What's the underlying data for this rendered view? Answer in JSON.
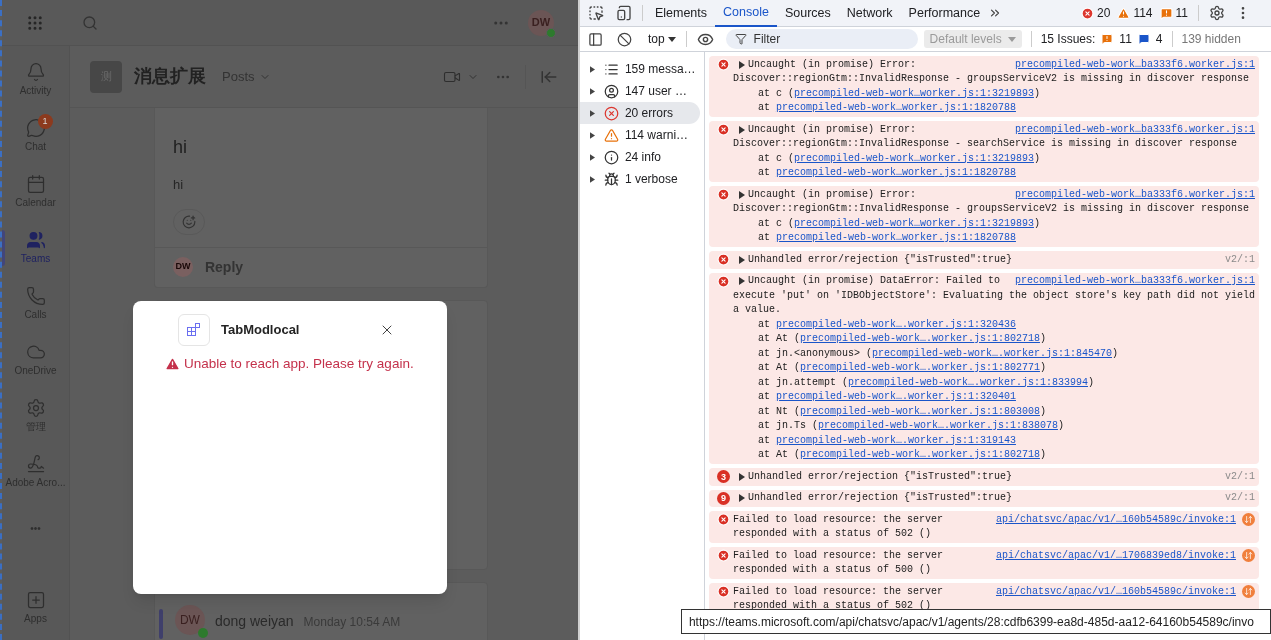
{
  "teams": {
    "top_bar": {
      "avatar": "DW"
    },
    "rail": [
      {
        "kind": "activity",
        "label": "Activity",
        "selected": false
      },
      {
        "kind": "chat",
        "label": "Chat",
        "selected": false,
        "badge": "1"
      },
      {
        "kind": "calendar",
        "label": "Calendar",
        "selected": false
      },
      {
        "kind": "teams",
        "label": "Teams",
        "selected": true
      },
      {
        "kind": "calls",
        "label": "Calls",
        "selected": false
      },
      {
        "kind": "onedrive",
        "label": "OneDrive",
        "selected": false
      },
      {
        "kind": "admin",
        "label": "管理",
        "selected": false
      },
      {
        "kind": "acrobat",
        "label": "Adobe Acro...",
        "selected": false
      },
      {
        "kind": "more",
        "label": "•••",
        "selected": false
      },
      {
        "kind": "apps",
        "label": "Apps",
        "selected": false
      }
    ],
    "channel": {
      "avatar": "测",
      "title": "消息扩展",
      "tab": "Posts"
    },
    "post": {
      "heading": "hi",
      "body": "hi",
      "reply": "Reply",
      "reply_avatar": "DW"
    },
    "last_post": {
      "avatar": "DW",
      "author": "dong weiyan",
      "time": "Monday 10:54 AM"
    },
    "dialog": {
      "title": "TabModlocal",
      "error": "Unable to reach app. Please try again."
    }
  },
  "devtools": {
    "tabs": [
      {
        "label": "Elements",
        "selected": false
      },
      {
        "label": "Console",
        "selected": true
      },
      {
        "label": "Sources",
        "selected": false
      },
      {
        "label": "Network",
        "selected": false
      },
      {
        "label": "Performance",
        "selected": false
      }
    ],
    "counts": {
      "errors": "20",
      "warnings": "114",
      "issues": "11"
    },
    "toolbar": {
      "context": "top",
      "filter_placeholder": "Filter",
      "levels": "Default levels",
      "levels_disabled": true,
      "issues_label": "15 Issues:",
      "issues_warn": "11",
      "issues_info": "4",
      "hidden": "139 hidden"
    },
    "sidebar": [
      {
        "kind": "messages",
        "label": "159 messa…",
        "selected": false
      },
      {
        "kind": "user",
        "label": "147 user …",
        "selected": false
      },
      {
        "kind": "errors",
        "label": "20 errors",
        "selected": true
      },
      {
        "kind": "warnings",
        "label": "114 warni…",
        "selected": false
      },
      {
        "kind": "info",
        "label": "24 info",
        "selected": false
      },
      {
        "kind": "verbose",
        "label": "1 verbose",
        "selected": false
      }
    ],
    "messages": [
      {
        "expandable": true,
        "head": "Uncaught (in promise) Error:",
        "source": "precompiled-web-work…ba333f6.worker.js:1",
        "source_link": true,
        "lines": [
          "Discover::regionGtm::InvalidResponse - groupsServiceV2 is missing in discover response"
        ],
        "stack": [
          {
            "pre": "at c (",
            "link": "precompiled-web-work…worker.js:1:3219893",
            "post": ")"
          },
          {
            "pre": "at ",
            "link": "precompiled-web-work…worker.js:1:1820788"
          }
        ]
      },
      {
        "expandable": true,
        "head": "Uncaught (in promise) Error:",
        "source": "precompiled-web-work…ba333f6.worker.js:1",
        "source_link": true,
        "lines": [
          "Discover::regionGtm::InvalidResponse - searchService is missing in discover response"
        ],
        "stack": [
          {
            "pre": "at c (",
            "link": "precompiled-web-work…worker.js:1:3219893",
            "post": ")"
          },
          {
            "pre": "at ",
            "link": "precompiled-web-work…worker.js:1:1820788"
          }
        ]
      },
      {
        "expandable": true,
        "head": "Uncaught (in promise) Error:",
        "source": "precompiled-web-work…ba333f6.worker.js:1",
        "source_link": true,
        "lines": [
          "Discover::regionGtm::InvalidResponse - groupsServiceV2 is missing in discover response"
        ],
        "stack": [
          {
            "pre": "at c (",
            "link": "precompiled-web-work…worker.js:1:3219893",
            "post": ")"
          },
          {
            "pre": "at ",
            "link": "precompiled-web-work…worker.js:1:1820788"
          }
        ]
      },
      {
        "expandable": true,
        "head": "Unhandled error/rejection {\"isTrusted\":true}",
        "source": "v2/:1",
        "source_link": false
      },
      {
        "expandable": true,
        "head": "Uncaught (in promise) DataError: Failed to",
        "source": "precompiled-web-work…ba333f6.worker.js:1",
        "source_link": true,
        "lines": [
          "execute 'put' on 'IDBObjectStore': Evaluating the object store's key path did not yield",
          "a value."
        ],
        "stack": [
          {
            "pre": "at ",
            "link": "precompiled-web-work….worker.js:1:320436"
          },
          {
            "pre": "at At (",
            "link": "precompiled-web-work….worker.js:1:802718",
            "post": ")"
          },
          {
            "pre": "at jn.<anonymous> (",
            "link": "precompiled-web-work….worker.js:1:845470",
            "post": ")"
          },
          {
            "pre": "at At (",
            "link": "precompiled-web-work….worker.js:1:802771",
            "post": ")"
          },
          {
            "pre": "at jn.attempt (",
            "link": "precompiled-web-work….worker.js:1:833994",
            "post": ")"
          },
          {
            "pre": "at ",
            "link": "precompiled-web-work….worker.js:1:320401"
          },
          {
            "pre": "at Nt (",
            "link": "precompiled-web-work….worker.js:1:803008",
            "post": ")"
          },
          {
            "pre": "at jn.Ts (",
            "link": "precompiled-web-work….worker.js:1:838078",
            "post": ")"
          },
          {
            "pre": "at ",
            "link": "precompiled-web-work….worker.js:1:319143"
          },
          {
            "pre": "at At (",
            "link": "precompiled-web-work….worker.js:1:802718",
            "post": ")"
          }
        ]
      },
      {
        "expandable": true,
        "count": "3",
        "head": "Unhandled error/rejection {\"isTrusted\":true}",
        "source": "v2/:1",
        "source_link": false
      },
      {
        "expandable": true,
        "count": "9",
        "head": "Unhandled error/rejection {\"isTrusted\":true}",
        "source": "v2/:1",
        "source_link": false
      },
      {
        "expandable": false,
        "network": true,
        "head": "Failed to load resource: the server",
        "source": "api/chatsvc/apac/v1/…160b54589c/invoke:1",
        "source_link": true,
        "lines": [
          "responded with a status of 502 ()"
        ]
      },
      {
        "expandable": false,
        "network": true,
        "head": "Failed to load resource: the server",
        "source": "api/chatsvc/apac/v1/…1706839ed8/invoke:1",
        "source_link": true,
        "lines": [
          "responded with a status of 500 ()"
        ]
      },
      {
        "expandable": false,
        "network": true,
        "head": "Failed to load resource: the server",
        "source": "api/chatsvc/apac/v1/…160b54589c/invoke:1",
        "source_link": true,
        "lines": [
          "responded with a status of 502 ()"
        ]
      }
    ],
    "tooltip": "https://teams.microsoft.com/api/chatsvc/apac/v1/agents/28:cdfb6399-ea8d-485d-aa12-64160b54589c/invo"
  }
}
